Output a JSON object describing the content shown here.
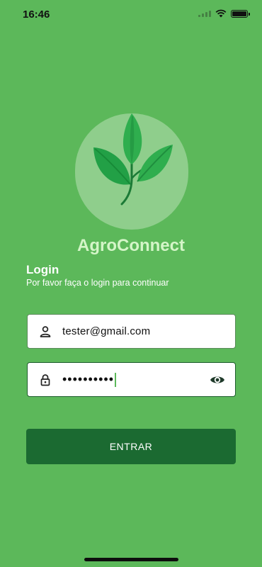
{
  "status_bar": {
    "time": "16:46"
  },
  "app": {
    "name": "AgroConnect"
  },
  "login": {
    "title": "Login",
    "subtitle": "Por favor faça o login para continuar"
  },
  "form": {
    "email_value": "tester@gmail.com",
    "password_value": "••••••••••",
    "submit_label": "ENTRAR"
  },
  "colors": {
    "background": "#5cb85a",
    "logo_circle": "#8fce8c",
    "leaf_light": "#3fbf5a",
    "leaf_dark": "#1b8a3c",
    "button": "#1b6a31"
  },
  "icons": {
    "email": "person-icon",
    "password": "lock-icon",
    "toggle": "eye-icon",
    "logo": "leaf-icon"
  }
}
